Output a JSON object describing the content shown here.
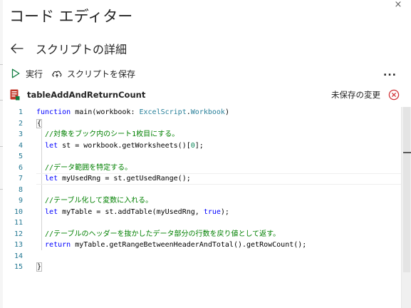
{
  "window": {
    "title": "コード エディター",
    "close_glyph": "×"
  },
  "subheader": {
    "back_icon": "arrow-left-icon",
    "label": "スクリプトの詳細"
  },
  "toolbar": {
    "run_icon": "play-icon",
    "run_label": "実行",
    "save_icon": "cloud-save-icon",
    "save_label": "スクリプトを保存",
    "more_label": "..."
  },
  "file": {
    "icon": "excel-script-icon",
    "name": "tableAddAndReturnCount",
    "status": "未保存の変更",
    "status_icon": "discard-x-circle-icon"
  },
  "colors": {
    "accent_green": "#107c41",
    "error_red": "#d13438",
    "keyword": "#0000ff",
    "type": "#267f99",
    "comment": "#008000",
    "number": "#098658",
    "line_number": "#237893"
  },
  "editor": {
    "line_numbers": [
      "1",
      "2",
      "3",
      "4",
      "5",
      "6",
      "7",
      "8",
      "9",
      "10",
      "11",
      "12",
      "13",
      "14",
      "15"
    ],
    "lines": {
      "l1": {
        "kw": "function",
        "rest": " main(workbook: ",
        "type": "ExcelScript",
        "dot": ".",
        "type2": "Workbook",
        "end": ")"
      },
      "l2": {
        "brace": "{"
      },
      "l3": {
        "comment": "  //対象をブック内のシート1枚目にする。"
      },
      "l4": {
        "kw": "  let",
        "rest": " st = workbook.getWorksheets()[",
        "num": "0",
        "end": "];"
      },
      "l5": {
        "text": ""
      },
      "l6": {
        "comment": "  //データ範囲を特定する。"
      },
      "l7": {
        "kw": "  let",
        "rest": " myUsedRng = st.getUsedRange();"
      },
      "l8": {
        "text": ""
      },
      "l9": {
        "comment": "  //テーブル化して変数に入れる。"
      },
      "l10": {
        "kw": "  let",
        "rest": " myTable = st.addTable(myUsedRng, ",
        "kw2": "true",
        "end": ");"
      },
      "l11": {
        "text": ""
      },
      "l12": {
        "comment": "  //テーブルのヘッダーを抜かしたデータ部分の行数を戻り値として返す。"
      },
      "l13": {
        "kw": "  return",
        "rest": " myTable.getRangeBetweenHeaderAndTotal().getRowCount();"
      },
      "l14": {
        "text": ""
      },
      "l15": {
        "brace": "}"
      }
    }
  }
}
